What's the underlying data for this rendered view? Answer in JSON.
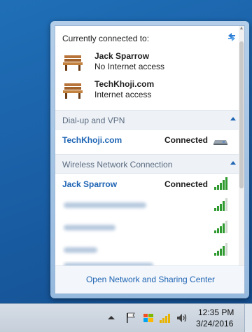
{
  "flyout": {
    "header": "Currently connected to:",
    "connected": [
      {
        "name": "Jack Sparrow",
        "status": "No Internet access"
      },
      {
        "name": "TechKhoji.com",
        "status": "Internet access"
      }
    ],
    "sections": [
      {
        "title": "Dial-up and VPN",
        "items": [
          {
            "name": "TechKhoji.com",
            "status": "Connected"
          }
        ]
      },
      {
        "title": "Wireless Network Connection",
        "items": [
          {
            "name": "Jack Sparrow",
            "status": "Connected"
          },
          {
            "name": "",
            "status": ""
          },
          {
            "name": "",
            "status": ""
          },
          {
            "name": "",
            "status": ""
          },
          {
            "name": "",
            "status": ""
          }
        ]
      }
    ],
    "footer_link": "Open Network and Sharing Center"
  },
  "taskbar": {
    "time": "12:35 PM",
    "date": "3/24/2016"
  },
  "icons": {
    "refresh": "refresh-icon",
    "connection": "bench-icon",
    "modem": "modem-icon",
    "wifi": "signal-icon",
    "flag": "flag-icon",
    "windows": "windows-icon",
    "network": "network-icon",
    "speaker": "speaker-icon"
  },
  "colors": {
    "link": "#1e64b4",
    "signal": "#2f9a2f",
    "desktop": "#1a5fa6"
  }
}
